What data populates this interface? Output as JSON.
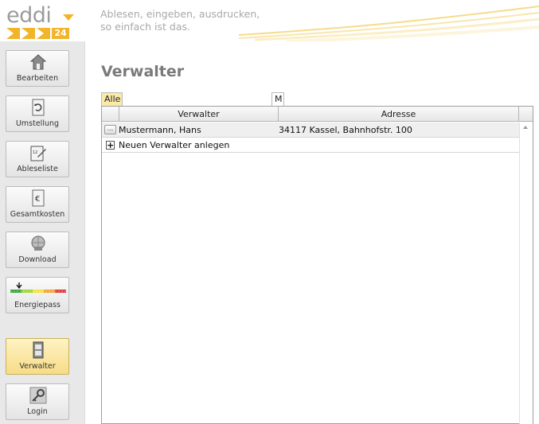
{
  "logo": {
    "word": "eddi",
    "number": "24"
  },
  "tagline": {
    "line1": "Ablesen, eingeben, ausdrucken,",
    "line2": "so einfach ist das."
  },
  "sidebar": {
    "items": [
      {
        "label": "Bearbeiten",
        "icon": "house-icon"
      },
      {
        "label": "Umstellung",
        "icon": "document-refresh-icon"
      },
      {
        "label": "Ableseliste",
        "icon": "clipboard-pen-icon"
      },
      {
        "label": "Gesamtkosten",
        "icon": "euro-document-icon"
      },
      {
        "label": "Download",
        "icon": "download-globe-icon"
      },
      {
        "label": "Energiepass",
        "icon": "energy-scale-icon"
      },
      {
        "label": "Verwalter",
        "icon": "phone-book-icon"
      },
      {
        "label": "Login",
        "icon": "key-icon"
      }
    ]
  },
  "main": {
    "title": "Verwalter",
    "tabs": [
      {
        "label": "Alle"
      },
      {
        "label": "M"
      }
    ],
    "grid": {
      "columns": [
        "Verwalter",
        "Adresse"
      ],
      "rows": [
        {
          "button": "...",
          "name": "Mustermann, Hans",
          "address": "34117 Kassel, Bahnhofstr. 100"
        }
      ],
      "add_row": {
        "button": "+",
        "label": "Neuen Verwalter anlegen"
      }
    }
  },
  "colors": {
    "accent": "#f2b42a",
    "active_nav": "#f8dc86",
    "active_tab": "#fbe9a8",
    "title": "#7a7a7a"
  }
}
